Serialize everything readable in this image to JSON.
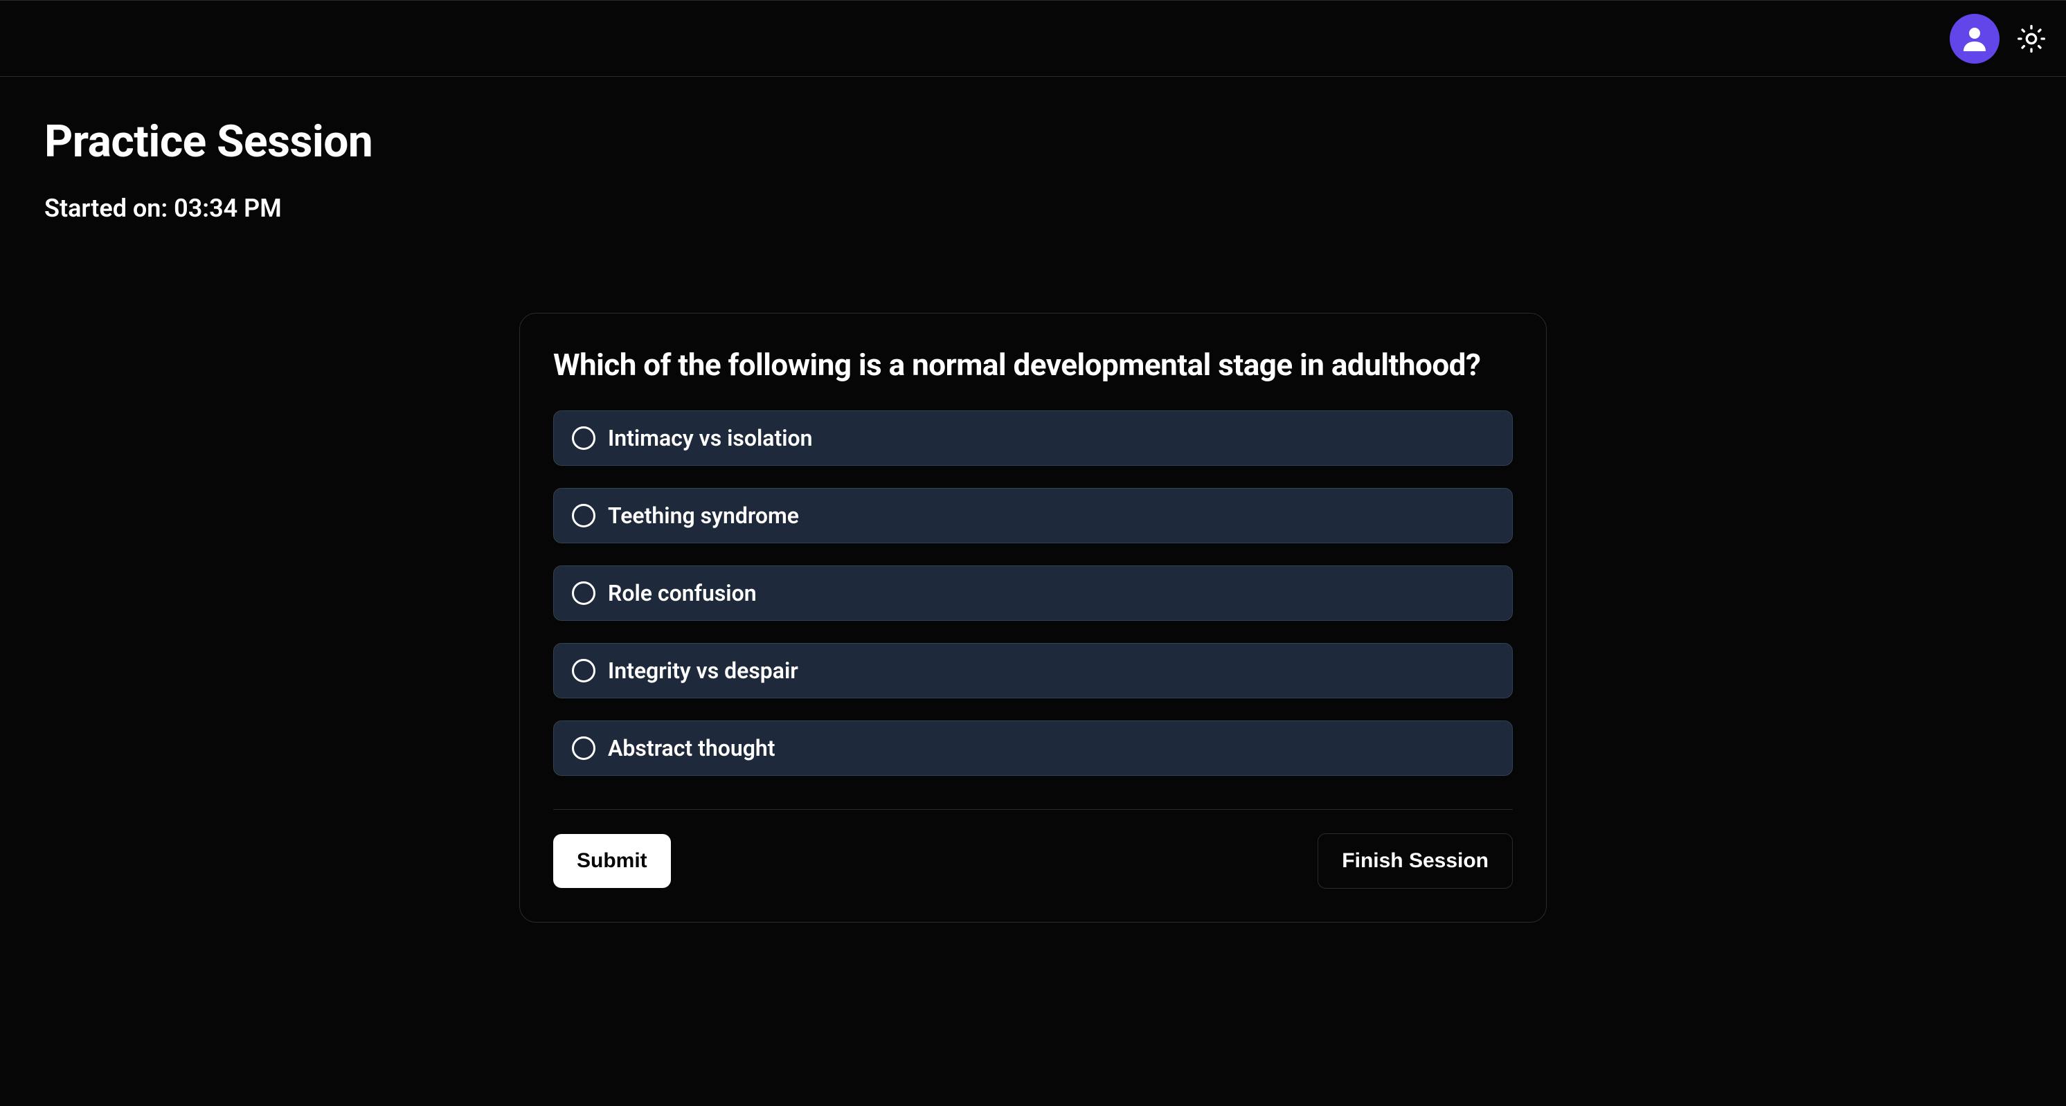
{
  "page": {
    "title": "Practice Session",
    "started_on_label": "Started on: 03:34 PM"
  },
  "question": {
    "text": "Which of the following is a normal developmental stage in adulthood?",
    "options": [
      "Intimacy vs isolation",
      "Teething syndrome",
      "Role confusion",
      "Integrity vs despair",
      "Abstract thought"
    ]
  },
  "actions": {
    "submit_label": "Submit",
    "finish_label": "Finish Session"
  }
}
